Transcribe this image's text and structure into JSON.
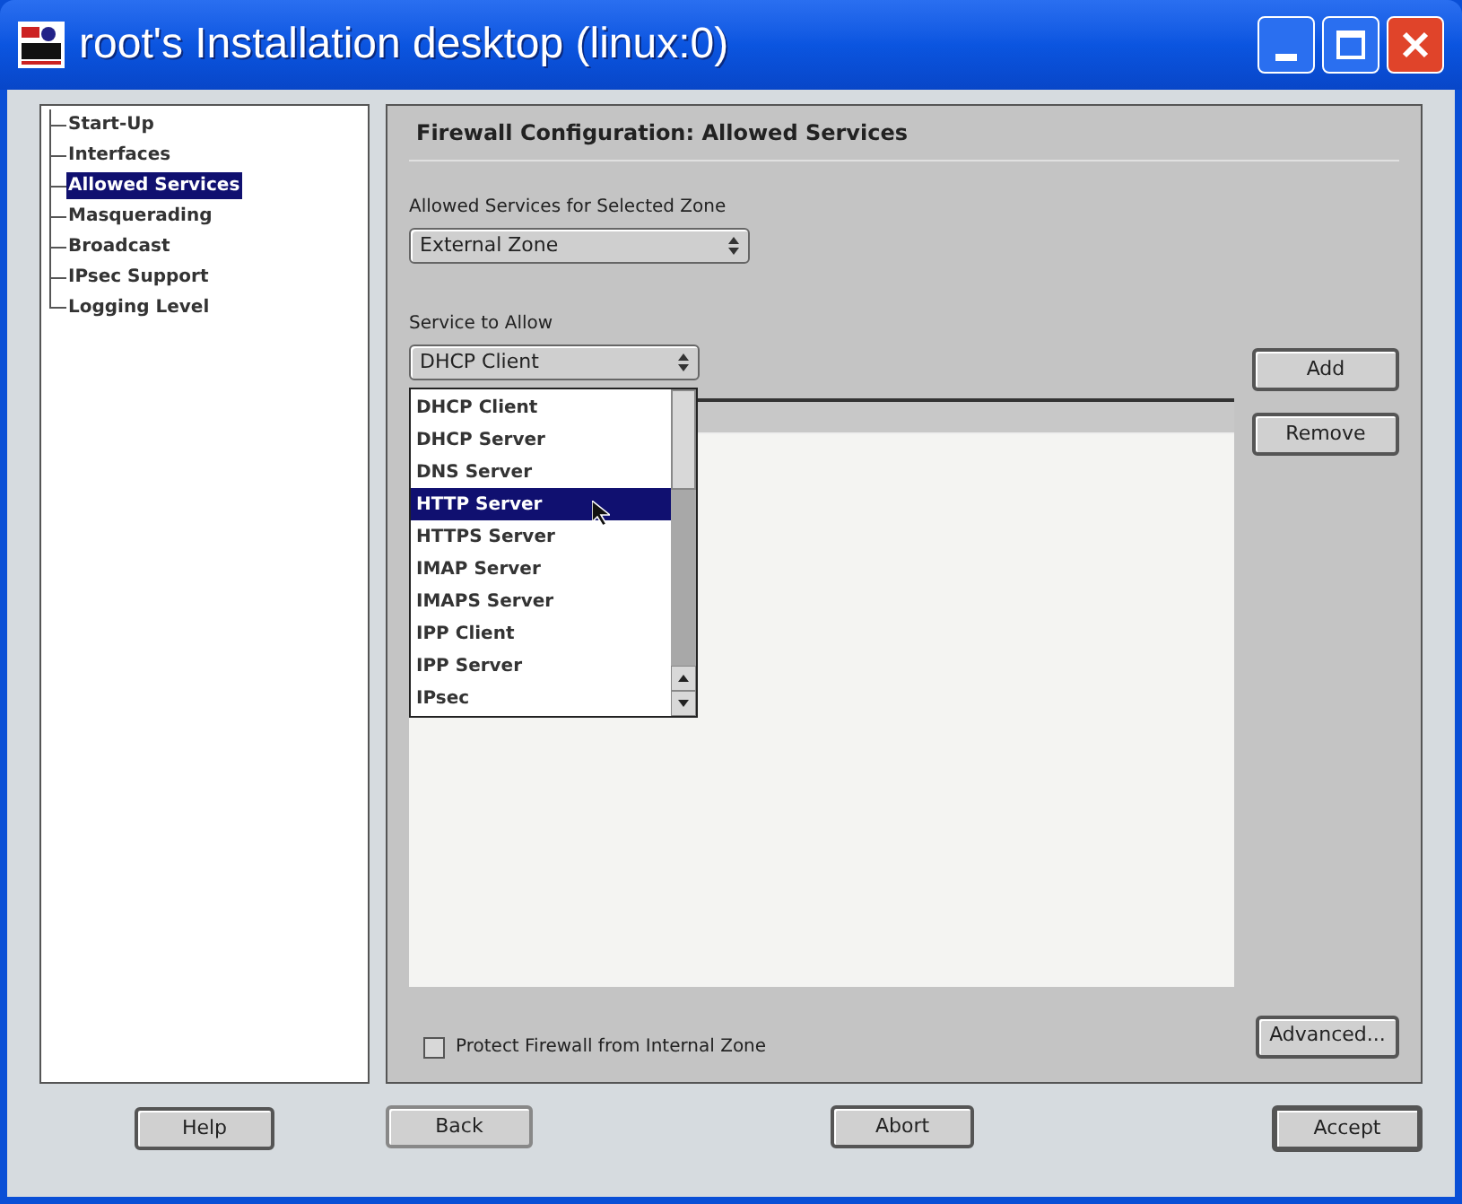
{
  "window": {
    "title": "root's Installation desktop (linux:0)"
  },
  "tree": {
    "items": [
      {
        "label": "Start-Up",
        "selected": false
      },
      {
        "label": "Interfaces",
        "selected": false
      },
      {
        "label": "Allowed Services",
        "selected": true
      },
      {
        "label": "Masquerading",
        "selected": false
      },
      {
        "label": "Broadcast",
        "selected": false
      },
      {
        "label": "IPsec Support",
        "selected": false
      },
      {
        "label": "Logging Level",
        "selected": false
      }
    ]
  },
  "panel": {
    "heading": "Firewall Configuration: Allowed Services",
    "zone_label": "Allowed Services for Selected Zone",
    "zone_value": "External Zone",
    "service_label": "Service to Allow",
    "service_value": "DHCP Client",
    "service_options": [
      {
        "label": "DHCP Client",
        "selected": false
      },
      {
        "label": "DHCP Server",
        "selected": false
      },
      {
        "label": "DNS Server",
        "selected": false
      },
      {
        "label": "HTTP Server",
        "selected": true
      },
      {
        "label": "HTTPS Server",
        "selected": false
      },
      {
        "label": "IMAP Server",
        "selected": false
      },
      {
        "label": "IMAPS Server",
        "selected": false
      },
      {
        "label": "IPP Client",
        "selected": false
      },
      {
        "label": "IPP Server",
        "selected": false
      },
      {
        "label": "IPsec",
        "selected": false
      }
    ],
    "add_button": "Add",
    "remove_button": "Remove",
    "advanced_button": "Advanced...",
    "protect_checkbox": {
      "label": "Protect Firewall from Internal Zone",
      "checked": false
    }
  },
  "footer": {
    "help": "Help",
    "back": {
      "label": "Back",
      "disabled": true
    },
    "abort": "Abort",
    "accept": "Accept"
  }
}
